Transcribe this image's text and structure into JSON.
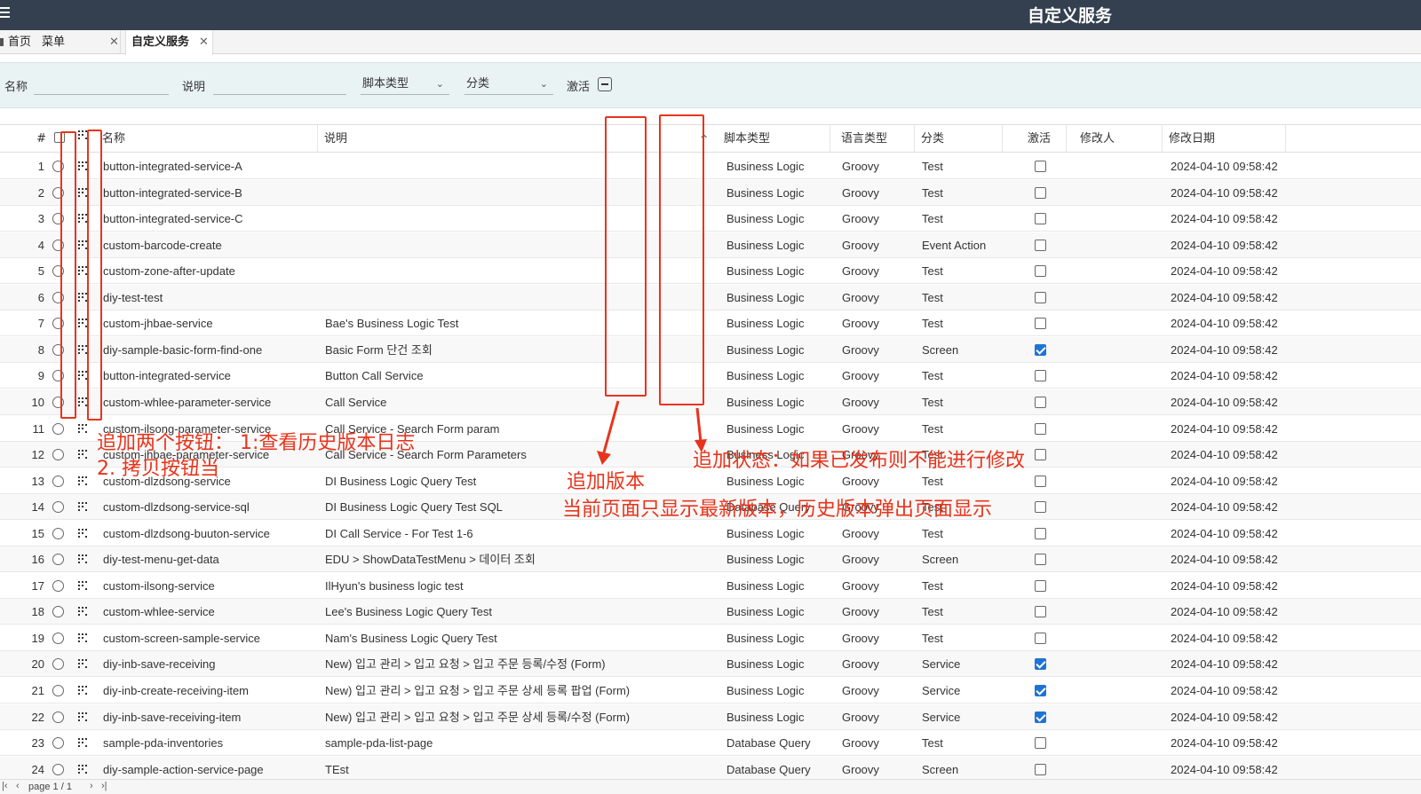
{
  "app": {
    "title": "自定义服务"
  },
  "tabs": {
    "home": "首页",
    "menu": "菜单",
    "active": "自定义服务",
    "close": "✕"
  },
  "filters": {
    "name_label": "名称",
    "desc_label": "说明",
    "script_type": "脚本类型",
    "category": "分类",
    "active_label": "激活"
  },
  "columns": {
    "num": "#",
    "name": "名称",
    "desc": "说明",
    "script_type": "脚本类型",
    "lang": "语言类型",
    "category": "分类",
    "active": "激活",
    "modifier": "修改人",
    "modified": "修改日期",
    "sort_glyph": "^"
  },
  "rows": [
    {
      "n": "1",
      "name": "button-integrated-service-A",
      "desc": "",
      "type": "Business Logic",
      "lang": "Groovy",
      "cat": "Test",
      "active": false,
      "date": "2024-04-10 09:58:42"
    },
    {
      "n": "2",
      "name": "button-integrated-service-B",
      "desc": "",
      "type": "Business Logic",
      "lang": "Groovy",
      "cat": "Test",
      "active": false,
      "date": "2024-04-10 09:58:42"
    },
    {
      "n": "3",
      "name": "button-integrated-service-C",
      "desc": "",
      "type": "Business Logic",
      "lang": "Groovy",
      "cat": "Test",
      "active": false,
      "date": "2024-04-10 09:58:42"
    },
    {
      "n": "4",
      "name": "custom-barcode-create",
      "desc": "",
      "type": "Business Logic",
      "lang": "Groovy",
      "cat": "Event Action",
      "active": false,
      "date": "2024-04-10 09:58:42"
    },
    {
      "n": "5",
      "name": "custom-zone-after-update",
      "desc": "",
      "type": "Business Logic",
      "lang": "Groovy",
      "cat": "Test",
      "active": false,
      "date": "2024-04-10 09:58:42"
    },
    {
      "n": "6",
      "name": "diy-test-test",
      "desc": "",
      "type": "Business Logic",
      "lang": "Groovy",
      "cat": "Test",
      "active": false,
      "date": "2024-04-10 09:58:42"
    },
    {
      "n": "7",
      "name": "custom-jhbae-service",
      "desc": "Bae's Business Logic Test",
      "type": "Business Logic",
      "lang": "Groovy",
      "cat": "Test",
      "active": false,
      "date": "2024-04-10 09:58:42"
    },
    {
      "n": "8",
      "name": "diy-sample-basic-form-find-one",
      "desc": "Basic Form 단건 조회",
      "type": "Business Logic",
      "lang": "Groovy",
      "cat": "Screen",
      "active": true,
      "date": "2024-04-10 09:58:42"
    },
    {
      "n": "9",
      "name": "button-integrated-service",
      "desc": "Button Call Service",
      "type": "Business Logic",
      "lang": "Groovy",
      "cat": "Test",
      "active": false,
      "date": "2024-04-10 09:58:42"
    },
    {
      "n": "10",
      "name": "custom-whlee-parameter-service",
      "desc": "Call Service",
      "type": "Business Logic",
      "lang": "Groovy",
      "cat": "Test",
      "active": false,
      "date": "2024-04-10 09:58:42"
    },
    {
      "n": "11",
      "name": "custom-ilsong-parameter-service",
      "desc": "Call Service - Search Form param",
      "type": "Business Logic",
      "lang": "Groovy",
      "cat": "Test",
      "active": false,
      "date": "2024-04-10 09:58:42"
    },
    {
      "n": "12",
      "name": "custom-jhbae-parameter-service",
      "desc": "Call Service - Search Form Parameters",
      "type": "Business Logic",
      "lang": "Groovy",
      "cat": "Test",
      "active": false,
      "date": "2024-04-10 09:58:42"
    },
    {
      "n": "13",
      "name": "custom-dlzdsong-service",
      "desc": "DI Business Logic Query Test",
      "type": "Business Logic",
      "lang": "Groovy",
      "cat": "Test",
      "active": false,
      "date": "2024-04-10 09:58:42"
    },
    {
      "n": "14",
      "name": "custom-dlzdsong-service-sql",
      "desc": "DI Business Logic Query Test SQL",
      "type": "Database Query",
      "lang": "Groovy",
      "cat": "Test",
      "active": false,
      "date": "2024-04-10 09:58:42"
    },
    {
      "n": "15",
      "name": "custom-dlzdsong-buuton-service",
      "desc": "DI Call Service - For Test 1-6",
      "type": "Business Logic",
      "lang": "Groovy",
      "cat": "Test",
      "active": false,
      "date": "2024-04-10 09:58:42"
    },
    {
      "n": "16",
      "name": "diy-test-menu-get-data",
      "desc": "EDU > ShowDataTestMenu > 데이터 조회",
      "type": "Business Logic",
      "lang": "Groovy",
      "cat": "Screen",
      "active": false,
      "date": "2024-04-10 09:58:42"
    },
    {
      "n": "17",
      "name": "custom-ilsong-service",
      "desc": "IlHyun's business logic test",
      "type": "Business Logic",
      "lang": "Groovy",
      "cat": "Test",
      "active": false,
      "date": "2024-04-10 09:58:42"
    },
    {
      "n": "18",
      "name": "custom-whlee-service",
      "desc": "Lee's Business Logic Query Test",
      "type": "Business Logic",
      "lang": "Groovy",
      "cat": "Test",
      "active": false,
      "date": "2024-04-10 09:58:42"
    },
    {
      "n": "19",
      "name": "custom-screen-sample-service",
      "desc": "Nam's Business Logic Query Test",
      "type": "Business Logic",
      "lang": "Groovy",
      "cat": "Test",
      "active": false,
      "date": "2024-04-10 09:58:42"
    },
    {
      "n": "20",
      "name": "diy-inb-save-receiving",
      "desc": "New) 입고 관리 > 입고 요청 > 입고 주문 등록/수정 (Form)",
      "type": "Business Logic",
      "lang": "Groovy",
      "cat": "Service",
      "active": true,
      "date": "2024-04-10 09:58:42"
    },
    {
      "n": "21",
      "name": "diy-inb-create-receiving-item",
      "desc": "New) 입고 관리 > 입고 요청 > 입고 주문 상세 등록 팝업 (Form)",
      "type": "Business Logic",
      "lang": "Groovy",
      "cat": "Service",
      "active": true,
      "date": "2024-04-10 09:58:42"
    },
    {
      "n": "22",
      "name": "diy-inb-save-receiving-item",
      "desc": "New) 입고 관리 > 입고 요청 > 입고 주문 상세 등록/수정 (Form)",
      "type": "Business Logic",
      "lang": "Groovy",
      "cat": "Service",
      "active": true,
      "date": "2024-04-10 09:58:42"
    },
    {
      "n": "23",
      "name": "sample-pda-inventories",
      "desc": "sample-pda-list-page",
      "type": "Database Query",
      "lang": "Groovy",
      "cat": "Test",
      "active": false,
      "date": "2024-04-10 09:58:42"
    },
    {
      "n": "24",
      "name": "diy-sample-action-service-page",
      "desc": "TEst",
      "type": "Database Query",
      "lang": "Groovy",
      "cat": "Screen",
      "active": false,
      "date": "2024-04-10 09:58:42"
    }
  ],
  "annotations": {
    "buttons_line1": "追加两个按钮： 1:查看历史版本日志",
    "buttons_line2": "2. 拷贝按钮当",
    "version_line1": "追加版本",
    "version_line2": "当前页面只显示最新版本，历史版本弹出页面显示",
    "status": "追加状态：如果已发布则不能进行修改",
    "color": "#e8341c"
  },
  "footer": {
    "page": "page 1 / 1",
    "first": "|‹",
    "prev": "‹",
    "next": "›",
    "last": "›|"
  }
}
